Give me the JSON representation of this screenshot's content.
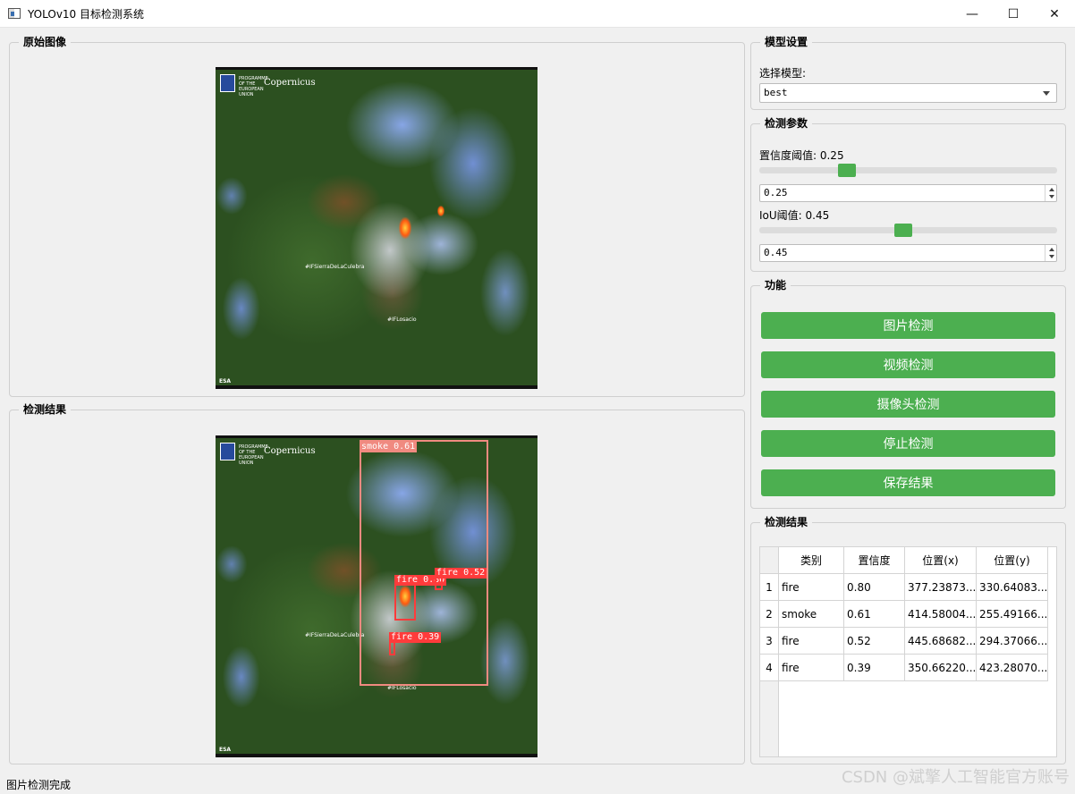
{
  "window": {
    "title": "YOLOv10 目标检测系统",
    "minimize_glyph": "—",
    "maximize_glyph": "☐",
    "close_glyph": "✕"
  },
  "original_panel": {
    "title": "原始图像"
  },
  "result_panel": {
    "title": "检测结果"
  },
  "image": {
    "place1": "#IFSierraDeLaCulebra",
    "place2": "#IFLosacio",
    "copernicus": "Copernicus",
    "eu_text": "PROGRAMME OF THE EUROPEAN UNION",
    "esa": "ESA"
  },
  "detections": [
    {
      "label": "smoke 0.61",
      "color": "#f08a80"
    },
    {
      "label": "fire 0.80",
      "color": "#ff3b3b"
    },
    {
      "label": "fire 0.52",
      "color": "#ff3b3b"
    },
    {
      "label": "fire 0.39",
      "color": "#ff3b3b"
    }
  ],
  "model_settings": {
    "title": "模型设置",
    "select_label": "选择模型:",
    "selected_model": "best"
  },
  "params": {
    "title": "检测参数",
    "conf_label": "置信度阈值: 0.25",
    "conf_value": "0.25",
    "conf_fraction": 0.25,
    "iou_label": "IoU阈值: 0.45",
    "iou_value": "0.45",
    "iou_fraction": 0.45
  },
  "functions": {
    "title": "功能",
    "image_detect": "图片检测",
    "video_detect": "视频检测",
    "camera_detect": "摄像头检测",
    "stop_detect": "停止检测",
    "save_result": "保存结果"
  },
  "results_table": {
    "title": "检测结果",
    "headers": [
      "类别",
      "置信度",
      "位置(x)",
      "位置(y)"
    ],
    "rows": [
      {
        "index": "1",
        "cls": "fire",
        "conf": "0.80",
        "x": "377.23873...",
        "y": "330.64083..."
      },
      {
        "index": "2",
        "cls": "smoke",
        "conf": "0.61",
        "x": "414.58004...",
        "y": "255.49166..."
      },
      {
        "index": "3",
        "cls": "fire",
        "conf": "0.52",
        "x": "445.68682...",
        "y": "294.37066..."
      },
      {
        "index": "4",
        "cls": "fire",
        "conf": "0.39",
        "x": "350.66220...",
        "y": "423.28070..."
      }
    ]
  },
  "status": "图片检测完成",
  "watermark": "CSDN @斌擎人工智能官方账号",
  "colors": {
    "accent": "#4caf50",
    "fire_box": "#ff3b3b",
    "smoke_box": "#f08a80"
  }
}
